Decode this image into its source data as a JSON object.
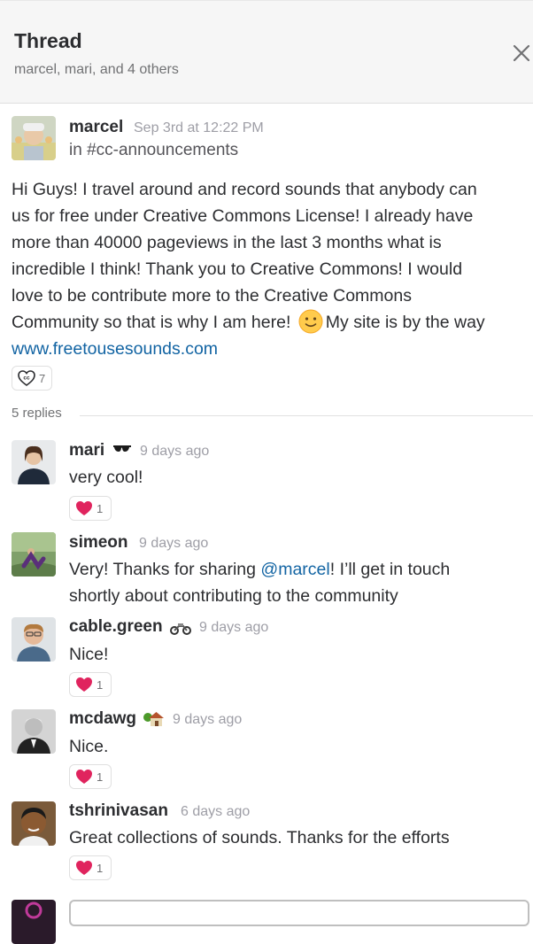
{
  "header": {
    "title": "Thread",
    "participants": "marcel, mari, and 4 others",
    "close_icon": "close-icon"
  },
  "parent": {
    "author": "marcel",
    "timestamp": "Sep 3rd at 12:22 PM",
    "channel": "in #cc-announcements",
    "lines": [
      "Hi Guys! I travel around and record sounds that anybody can",
      "us for free under Creative Commons License! I already have",
      "more than 40000 pageviews in the last 3 months what is",
      "incredible I think! Thank you to Creative Commons! I would",
      "love to be contribute more to the Creative Commons"
    ],
    "last_line_a": "Community so that is why I am here!",
    "last_line_b": "My site is by the way",
    "link": "www.freetousesounds.com",
    "reaction": {
      "icon": "creative-commons-heart-icon",
      "count": "7"
    }
  },
  "replies_label": "5 replies",
  "replies": [
    {
      "author": "mari",
      "timestamp": "9 days ago",
      "text": "very cool!",
      "reaction_count": "1",
      "status_icon": "sunglasses-icon"
    },
    {
      "author": "simeon",
      "timestamp": "9 days ago",
      "text_a": "Very! Thanks for sharing",
      "mention": "@marcel",
      "text_b": "! I’ll get in touch",
      "text_line2": "shortly about contributing to the community"
    },
    {
      "author": "cable.green",
      "timestamp": "9 days ago",
      "text": "Nice!",
      "reaction_count": "1",
      "status_icon": "motorcycle-icon"
    },
    {
      "author": "mcdawg",
      "timestamp": "9 days ago",
      "text": "Nice.",
      "reaction_count": "1",
      "status_icon": "house-with-garden-icon"
    },
    {
      "author": "tshrinivasan",
      "timestamp": "6 days ago",
      "text": "Great collections of sounds. Thanks for the efforts",
      "reaction_count": "1"
    }
  ],
  "colors": {
    "link": "#1264a3",
    "heart": "#e0245e",
    "header_bg": "#f6f6f6"
  }
}
